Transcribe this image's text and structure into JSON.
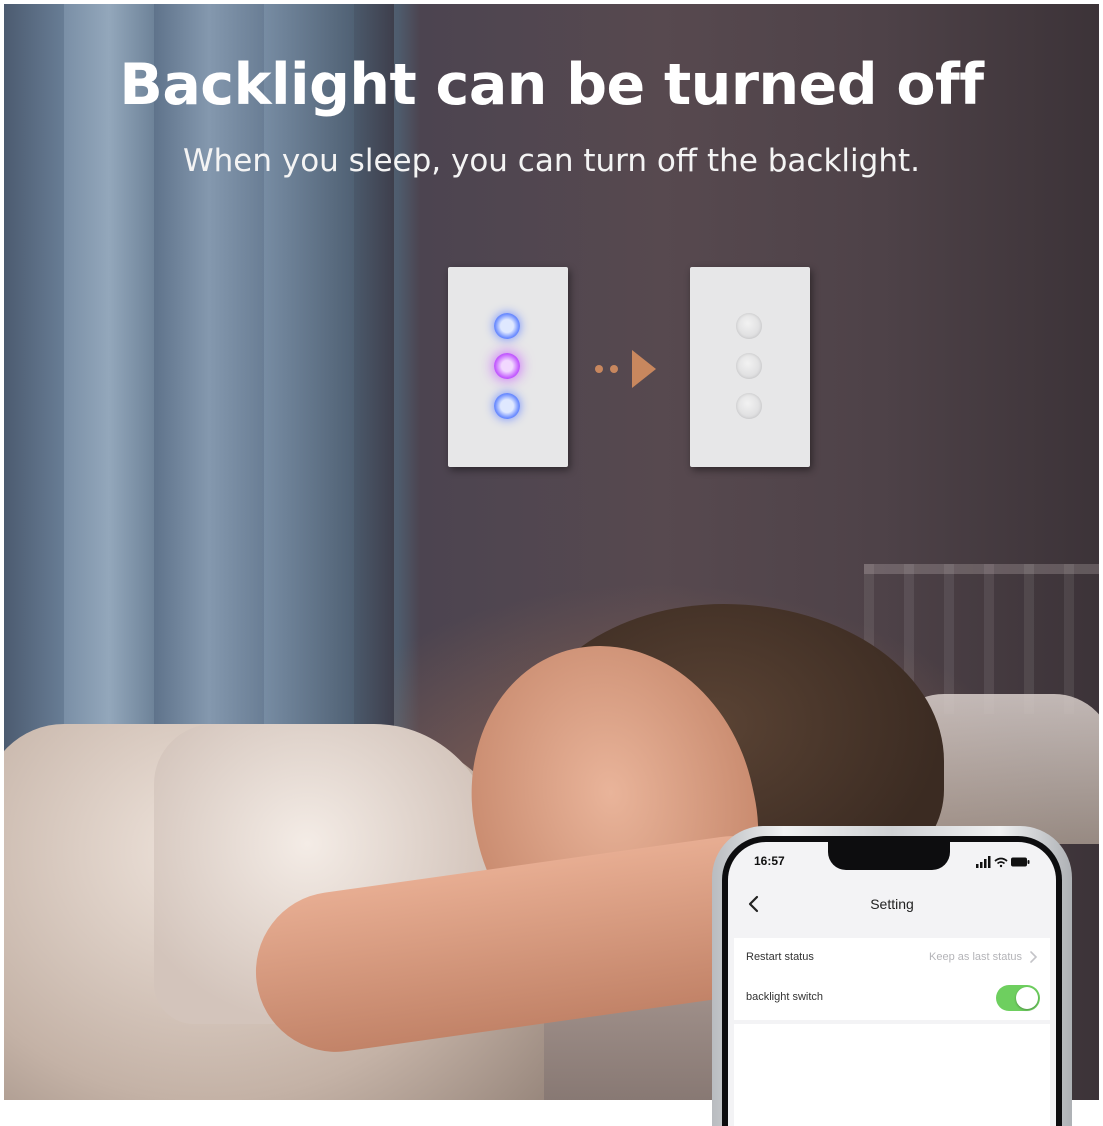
{
  "banner": {
    "headline": "Backlight can be turned off",
    "subheadline": "When you sleep,  you can turn off the backlight."
  },
  "illustration": {
    "before_plate": {
      "buttons": 3,
      "backlight": "on",
      "colors": [
        "#6d8dff",
        "#c35cff",
        "#6d8dff"
      ]
    },
    "after_plate": {
      "buttons": 3,
      "backlight": "off"
    },
    "arrow_icon": "arrow-right-icon",
    "arrow_color": "#c8875e"
  },
  "phone": {
    "status_bar": {
      "time": "16:57",
      "icons": [
        "signal-icon",
        "wifi-icon",
        "battery-icon"
      ]
    },
    "nav": {
      "back_icon": "chevron-left-icon",
      "title": "Setting"
    },
    "settings": [
      {
        "label": "Restart status",
        "value": "Keep as last status",
        "icon": "chevron-right-icon"
      },
      {
        "label": "backlight switch",
        "toggle_on": true,
        "toggle_color": "#6ecf5f"
      }
    ]
  }
}
